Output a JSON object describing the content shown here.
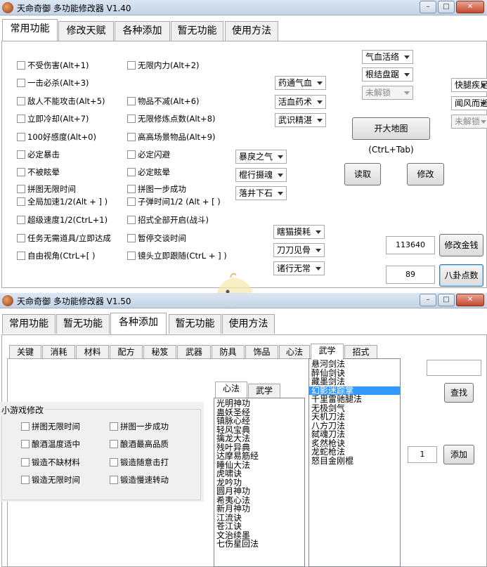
{
  "win1": {
    "title": "天命奇御 多功能修改器 V1.40",
    "tabs": [
      "常用功能",
      "修改天赋",
      "各种添加",
      "暂无功能",
      "使用方法"
    ],
    "checks_left": [
      "不受伤害(Alt+1)",
      "一击必杀(Alt+3)",
      "敌人不能攻击(Alt+5)",
      "立即冷却(Alt+7)",
      "100好感度(Alt+0)",
      "必定暴击",
      "不被眩晕",
      "拼图无限时间",
      "全局加速1/2(Alt + ] )",
      "超级速度1/2(CtrL+1)",
      "任务无需道具/立即达成",
      "自由视角(CtrL+[ )"
    ],
    "checks_mid": [
      "无限内力(Alt+2)",
      "物品不减(Alt+6)",
      "无限修炼点数(Alt+8)",
      "高高场景物品(Alt+9)",
      "必定闪避",
      "必定眩晕",
      "拼图一步成功",
      "子弹时间1/2 (Alt + [ )",
      "招式全部开启(战斗)",
      "暂停交谈时间",
      "镜头立即跟随(CtrL + ] )"
    ],
    "combos_a": [
      "暴戾之气",
      "棍行摄魂",
      "落井下石"
    ],
    "combos_b": [
      "药通气血",
      "活血药术",
      "武识精湛"
    ],
    "combos_c": [
      "瞎猫摸耗",
      "刀刀见骨",
      "诸行无常"
    ],
    "combos_d": [
      "气血活络",
      "根结盘踞",
      "未解锁"
    ],
    "combos_e": [
      "快腿疾足",
      "闻风而逝",
      "未解锁"
    ],
    "btn_map": "开大地图(CtrL+Tab)",
    "btn_read": "读取",
    "btn_modify": "修改",
    "money_value": "113640",
    "btn_money": "修改金钱",
    "bagua_value": "89",
    "btn_bagua": "八卦点数"
  },
  "win2": {
    "title": "天命奇御 多功能修改器 V1.50",
    "tabs": [
      "常用功能",
      "暂无功能",
      "各种添加",
      "暂无功能",
      "使用方法"
    ],
    "subtabs": [
      "关键",
      "消耗",
      "材料",
      "配方",
      "秘笈",
      "武器",
      "防具",
      "饰品",
      "心法",
      "武学",
      "招式"
    ],
    "group_label": "小游戏修改",
    "group_left": [
      "拼图无限时间",
      "酿酒温度适中",
      "锻造不缺材料",
      "锻造无限时间"
    ],
    "group_right": [
      "拼图一步成功",
      "酿酒最高品质",
      "锻造随意击打",
      "锻造慢速转动"
    ],
    "inner_tabs": [
      "心法",
      "武学"
    ],
    "xinfa_list": [
      "光明神功",
      "蛊妖圣经",
      "镇脉心经",
      "轻风宝典",
      "擒龙大法",
      "残叶异典",
      "达摩易筋经",
      "睡仙大法",
      "虎啸诀",
      "龙吟功",
      "圆月神功",
      "希夷心法",
      "新月神功",
      "江流诀",
      "苍江诀",
      "文治续墨",
      "七伤星回法"
    ],
    "wuxue_list": [
      "悬河剑法",
      "醉仙剑诀",
      "藏墨剑法",
      "幻影迷踪掌",
      "千里雷驰腿法",
      "无极剑气",
      "天机刀法",
      "八方刀法",
      "弑魂刀法",
      "炙然枪诀",
      "龙蛇枪法",
      "怒目金刚棍"
    ],
    "selected_index": 3,
    "search_value": "",
    "btn_search": "查找",
    "qty_value": "1",
    "btn_add": "添加"
  }
}
